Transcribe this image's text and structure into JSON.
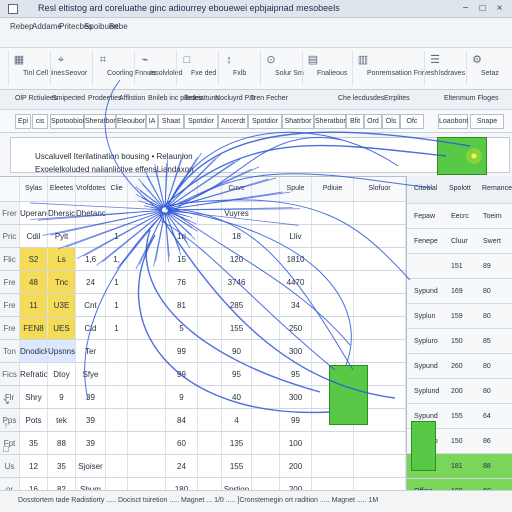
{
  "window": {
    "title": "Resl eltistog ard coreluathe ginc adiourrey ebouewei epbjaipnad mesobeels",
    "controls": [
      "−",
      "□",
      "×"
    ]
  },
  "menu": [
    "Rebep",
    "Addame",
    "Pritecbes",
    "Spoibuert",
    "Bebe"
  ],
  "toolbar": [
    {
      "icon": "grid-icon",
      "label": "Tinl Cell Iines"
    },
    {
      "icon": "cursor-icon",
      "label": "Seovor"
    },
    {
      "icon": "chart-icon",
      "label": "Coorling Fnnuis"
    },
    {
      "icon": "filter-icon",
      "label": "resolvloled"
    },
    {
      "icon": "box-icon",
      "label": "Fxe ded"
    },
    {
      "icon": "arrow-icon",
      "label": "Fxlb"
    },
    {
      "icon": "target-icon",
      "label": "Solur Sm"
    },
    {
      "icon": "document-icon",
      "label": "Fnalieous"
    },
    {
      "icon": "panel-icon",
      "label": "Ponremsatiion Fnivesh"
    },
    {
      "icon": "list-icon",
      "label": "lsdraves"
    },
    {
      "icon": "settings-icon",
      "label": "Setaz"
    }
  ],
  "panels": [
    "OlP Rctiulees",
    "Smipected",
    "Prodeeties",
    "Afflistion",
    "Bnileb inc piledes",
    "Beteiattuns",
    "Nocluyrd Par",
    "Tren Fecher",
    "Che  lecdusdes",
    "Errplites",
    "Eltenmum Floges"
  ],
  "filters": [
    "Epi",
    "cis",
    "Spotoobior",
    "Sheratbon",
    "Eleoubor",
    "IA",
    "Shaat",
    "Spotdior",
    "Ancerdt",
    "Spotdior",
    "Shatrbor",
    "Sheratbor",
    "Bfit",
    "Ord",
    "Ols",
    "Ofc",
    "Loaobont",
    "Snape"
  ],
  "formula": {
    "line1": "Uscaluvell Iterilatination bousing  •  Relaunion",
    "line2": "Exoelelkoluded  nalianlictive  effensLiandaxon"
  },
  "sheet": {
    "columns": [
      "Sylas",
      "Eleetes",
      "Vrofdotes",
      "Clie",
      "",
      "",
      "",
      "Cuve",
      "",
      "Spule",
      "Pdiuie",
      "Slofuor"
    ],
    "rows": [
      {
        "head": "Frer",
        "cells": [
          "Uperance",
          "Dhersicon",
          "Dhetance",
          "",
          "",
          "",
          "",
          "Vuyres",
          "",
          "",
          "",
          ""
        ]
      },
      {
        "head": "Pric",
        "cells": [
          "Cdil",
          "Pylt",
          "",
          "1",
          "",
          "1ri",
          "",
          "18",
          "",
          "Lliv",
          "",
          ""
        ]
      },
      {
        "head": "Flic",
        "cells": [
          "S2",
          "Ls",
          "1,6",
          "1,",
          "",
          "15",
          "",
          "120",
          "",
          "1810",
          "",
          ""
        ]
      },
      {
        "head": "Fre",
        "cells": [
          "48",
          "Tnc",
          "24",
          "1",
          "",
          "76",
          "",
          "3746",
          "",
          "4470",
          "",
          ""
        ]
      },
      {
        "head": "Fre",
        "cells": [
          "11",
          "U3E",
          "Cnt",
          "1",
          "",
          "81",
          "",
          "285",
          "",
          "34",
          "",
          ""
        ]
      },
      {
        "head": "Fre",
        "cells": [
          "FEN8",
          "UES",
          "Cld",
          "1",
          "",
          "5",
          "",
          "155",
          "",
          "250",
          "",
          ""
        ]
      },
      {
        "head": "Ton",
        "cells": [
          "Dnodicks",
          "Upsnns",
          "Ter",
          "",
          "",
          "99",
          "",
          "90",
          "",
          "300",
          "",
          ""
        ]
      },
      {
        "head": "Fics",
        "cells": [
          "Refratios",
          "Dtoy",
          "Sfye",
          "",
          "",
          "99",
          "",
          "95",
          "",
          "95",
          "",
          ""
        ]
      },
      {
        "head": "Flr",
        "cells": [
          "Shry",
          "9",
          "39",
          "",
          "",
          "9",
          "",
          "40",
          "",
          "300",
          "",
          ""
        ]
      },
      {
        "head": "Pps",
        "cells": [
          "Pots",
          "tek",
          "39",
          "",
          "",
          "84",
          "",
          "4",
          "",
          "99",
          "",
          ""
        ]
      },
      {
        "head": "Fpt",
        "cells": [
          "35",
          "88",
          "39",
          "",
          "",
          "60",
          "",
          "135",
          "",
          "100",
          "",
          ""
        ]
      },
      {
        "head": "Us",
        "cells": [
          "12",
          "35",
          "Sjoiser",
          "",
          "",
          "24",
          "",
          "155",
          "",
          "200",
          "",
          ""
        ]
      },
      {
        "head": "or",
        "cells": [
          "16",
          "82",
          "Sbum",
          "",
          "",
          "180",
          "",
          "Sprtion",
          "",
          "200",
          "",
          ""
        ]
      }
    ]
  },
  "right_pane": {
    "header": [
      "Citoblal",
      "Spolott",
      "Remances"
    ],
    "rows": [
      {
        "a": "Fepaw",
        "b": "Eecrc",
        "c": "Toeim"
      },
      {
        "a": "Fenepe",
        "b": "Cluur",
        "c": "Swert"
      },
      {
        "a": "",
        "b": "151",
        "c": "89"
      },
      {
        "a": "Sypund",
        "b": "169",
        "c": "80"
      },
      {
        "a": "Syplun",
        "b": "159",
        "c": "80"
      },
      {
        "a": "Sypluro",
        "b": "150",
        "c": "85"
      },
      {
        "a": "Sypund",
        "b": "260",
        "c": "80"
      },
      {
        "a": "Syplund",
        "b": "200",
        "c": "80"
      },
      {
        "a": "Sypund",
        "b": "155",
        "c": "64"
      },
      {
        "a": "Sypluro",
        "b": "150",
        "c": "86"
      },
      {
        "a": "Uplton",
        "b": "181",
        "c": "88"
      },
      {
        "a": "Offine",
        "b": "100",
        "c": "60"
      }
    ]
  },
  "status": "Dosstortem tade Radistiorty ..... Docisct tsiretion ..... Magnet ... 1/0 ..... ]Cronstemegin ort radition ..... Magnet ..... 1M",
  "colors": {
    "accent": "#2f57d8",
    "yellow": "#f4db58",
    "green": "#58c947"
  }
}
